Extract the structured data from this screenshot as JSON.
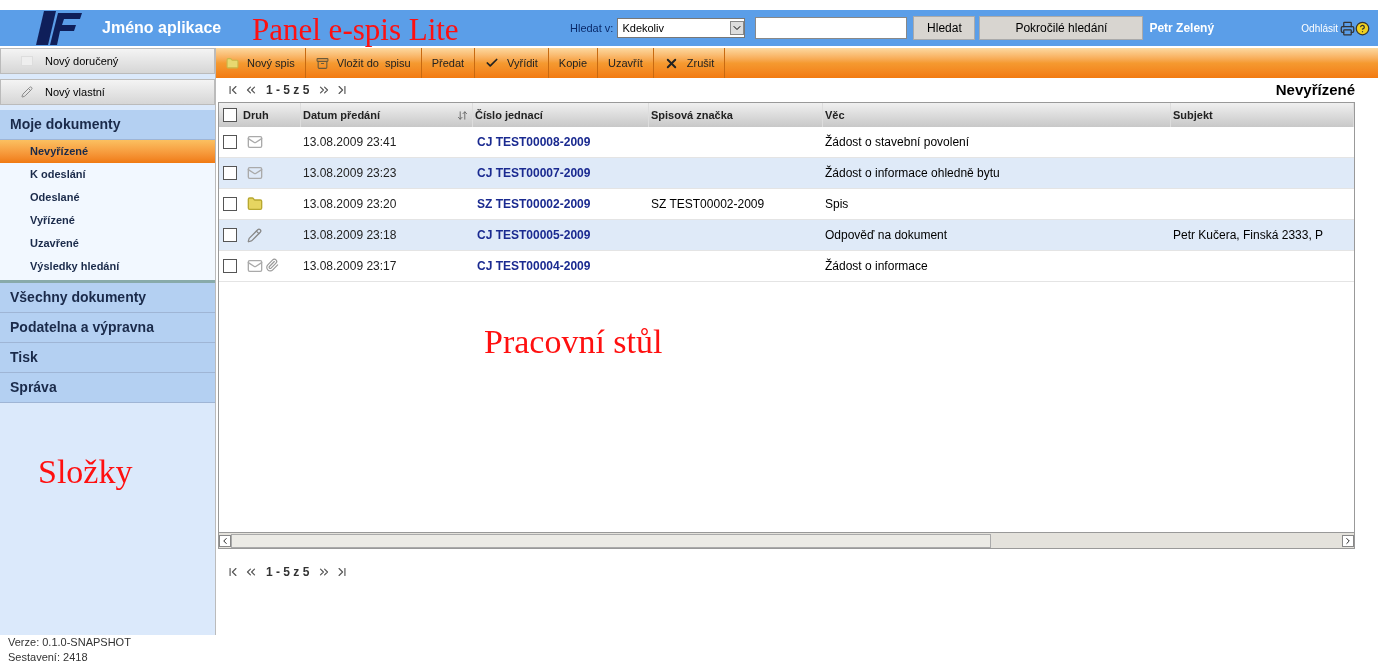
{
  "header": {
    "app_name": "Jméno aplikace",
    "search_label": "Hledat v:",
    "search_scope": "Kdekoliv",
    "search_button": "Hledat",
    "advanced_button": "Pokročilé hledání",
    "user": "Petr Zelený",
    "logout": "Odhlásit"
  },
  "sidebar": {
    "buttons": [
      {
        "label": "Nový doručený",
        "kind": "blank"
      },
      {
        "label": "Nový vlastní",
        "kind": "pencil"
      }
    ],
    "sections": [
      {
        "label": "Moje dokumenty",
        "items": [
          {
            "label": "Nevyřízené",
            "selected": true
          },
          {
            "label": "K odeslání",
            "selected": false
          },
          {
            "label": "Odeslané",
            "selected": false
          },
          {
            "label": "Vyřízené",
            "selected": false
          },
          {
            "label": "Uzavřené",
            "selected": false
          },
          {
            "label": "Výsledky hledání",
            "selected": false
          }
        ]
      },
      {
        "label": "Všechny dokumenty"
      },
      {
        "label": "Podatelna a výpravna"
      },
      {
        "label": "Tisk"
      },
      {
        "label": "Správa"
      }
    ]
  },
  "toolbar": [
    {
      "label": "Nový spis",
      "kind": "folder"
    },
    {
      "label": "Vložit do  spisu",
      "kind": "box"
    },
    {
      "label": "Předat",
      "kind": "none"
    },
    {
      "label": "Vyřídit",
      "kind": "check"
    },
    {
      "label": "Kopie",
      "kind": "none"
    },
    {
      "label": "Uzavřít",
      "kind": "none"
    },
    {
      "label": "Zrušit",
      "kind": "cross"
    }
  ],
  "pager_top": "1 - 5 z 5",
  "view_title": "Nevyřízené",
  "table": {
    "select_all_checked": false,
    "columns": [
      "Druh",
      "Datum předání",
      "Číslo jednací",
      "Spisová značka",
      "Věc",
      "Subjekt"
    ],
    "rows": [
      {
        "checked": false,
        "kind": "mail",
        "date": "13.08.2009 23:41",
        "number": "CJ TEST00008-2009",
        "subject": "Žádost o stavební povolení"
      },
      {
        "checked": false,
        "kind": "mail",
        "date": "13.08.2009 23:23",
        "number": "CJ TEST00007-2009",
        "subject": "Žádost o informace ohledně bytu"
      },
      {
        "checked": false,
        "kind": "folder",
        "date": "13.08.2009 23:20",
        "number": "SZ TEST00002-2009",
        "file_mark": "SZ TEST00002-2009",
        "subject": "Spis"
      },
      {
        "checked": false,
        "kind": "pencil",
        "date": "13.08.2009 23:18",
        "number": "CJ TEST00005-2009",
        "subject": "Odpověď na dokument",
        "party": "Petr Kučera, Finská 2333, P"
      },
      {
        "checked": false,
        "kind": "mail_attachment",
        "date": "13.08.2009 23:17",
        "number": "CJ TEST00004-2009",
        "subject": "Žádost o informace"
      }
    ]
  },
  "pager_bottom": "1 - 5 z 5",
  "footer": [
    "Verze: 0.1.0-SNAPSHOT",
    "Sestavení: 2418"
  ],
  "annotations": [
    "Panel e-spis Lite",
    "Pracovní stůl",
    "Složky"
  ]
}
